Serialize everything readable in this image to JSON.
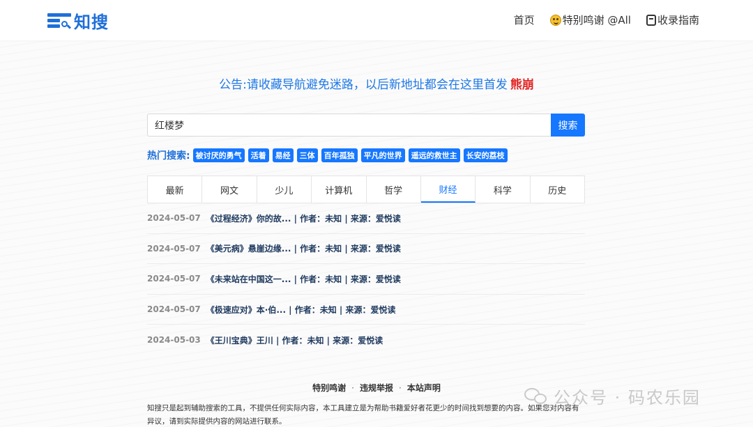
{
  "brand": {
    "name": "知搜"
  },
  "nav": {
    "home": "首页",
    "thanks": "特别鸣谢 @All",
    "guide": "收录指南"
  },
  "notice": {
    "text": "公告:请收藏导航避免迷路，以后新地址都会在这里首发",
    "highlight": "熊崩"
  },
  "search": {
    "value": "红楼梦",
    "button": "搜索"
  },
  "hot": {
    "label": "热门搜索:",
    "tags": [
      "被讨厌的勇气",
      "活着",
      "易经",
      "三体",
      "百年孤独",
      "平凡的世界",
      "遥远的救世主",
      "长安的荔枝"
    ]
  },
  "tabs": [
    "最新",
    "网文",
    "少儿",
    "计算机",
    "哲学",
    "财经",
    "科学",
    "历史"
  ],
  "active_tab": "财经",
  "results": [
    {
      "date": "2024-05-07",
      "title": "《过程经济》你的故... | 作者：未知 | 来源：爱悦读"
    },
    {
      "date": "2024-05-07",
      "title": "《美元病》悬崖边缘... | 作者：未知 | 来源：爱悦读"
    },
    {
      "date": "2024-05-07",
      "title": "《未来站在中国这一... | 作者：未知 | 来源：爱悦读"
    },
    {
      "date": "2024-05-07",
      "title": "《极速应对》本·伯... | 作者：未知 | 来源：爱悦读"
    },
    {
      "date": "2024-05-03",
      "title": "《王川宝典》王川 | 作者：未知 | 来源：爱悦读"
    }
  ],
  "footer": {
    "links": [
      "特别鸣谢",
      "违规举报",
      "本站声明"
    ],
    "separator": "·",
    "disclaimer": "知搜只是起到辅助搜索的工具，不提供任何实际内容，本工具建立是为帮助书籍爱好者花更少的时间找到想要的内容。如果您对内容有异议，请到实际提供内容的网站进行联系。"
  },
  "watermark": {
    "text": "公众号 · 码农乐园"
  },
  "colors": {
    "accent": "#1677ff",
    "brand": "#1e6fd9",
    "highlight": "#e32626"
  }
}
